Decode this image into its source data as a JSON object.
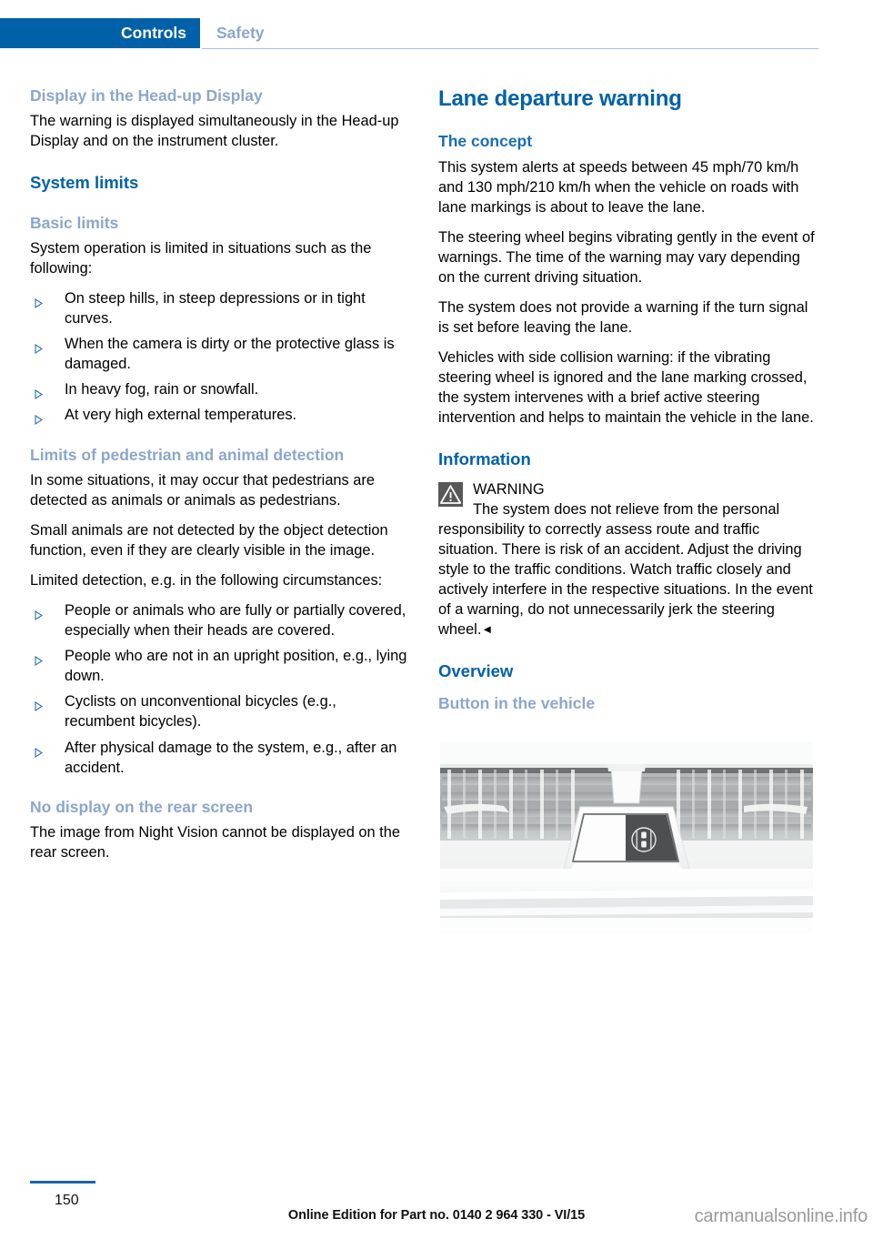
{
  "header": {
    "tab_active": "Controls",
    "tab_inactive": "Safety",
    "accent_color": "#0061a8",
    "muted_color": "#8ba7cc"
  },
  "left_column": {
    "h3_headup": "Display in the Head-up Display",
    "p_headup": "The warning is displayed simultaneously in the Head-up Display and on the instrument cluster.",
    "h2_system_limits": "System limits",
    "h3_basic_limits": "Basic limits",
    "p_basic_intro": "System operation is limited in situations such as the following:",
    "basic_limits_items": [
      "On steep hills, in steep depressions or in tight curves.",
      "When the camera is dirty or the protective glass is damaged.",
      "In heavy fog, rain or snowfall.",
      "At very high external temperatures."
    ],
    "h3_limits_detection": "Limits of pedestrian and animal detection",
    "p_detection_1": "In some situations, it may occur that pedestrians are detected as animals or animals as pedestrians.",
    "p_detection_2": "Small animals are not detected by the object detection function, even if they are clearly visible in the image.",
    "p_detection_3": "Limited detection, e.g. in the following circumstances:",
    "detection_items": [
      "People or animals who are fully or partially covered, especially when their heads are covered.",
      "People who are not in an upright position, e.g., lying down.",
      "Cyclists on unconventional bicycles (e.g., recumbent bicycles).",
      "After physical damage to the system, e.g., after an accident."
    ],
    "h3_no_display": "No display on the rear screen",
    "p_no_display": "The image from Night Vision cannot be displayed on the rear screen."
  },
  "right_column": {
    "h1_title": "Lane departure warning",
    "h3_concept": "The concept",
    "p_concept_1": "This system alerts at speeds between 45 mph/70 km/h and 130 mph/210 km/h when the vehicle on roads with lane markings is about to leave the lane.",
    "p_concept_2": "The steering wheel begins vibrating gently in the event of warnings. The time of the warning may vary depending on the current driving situation.",
    "p_concept_3": "The system does not provide a warning if the turn signal is set before leaving the lane.",
    "p_concept_4": "Vehicles with side collision warning: if the vibrating steering wheel is ignored and the lane marking crossed, the system intervenes with a brief active steering intervention and helps to maintain the vehicle in the lane.",
    "h2_information": "Information",
    "warning_label": "WARNING",
    "warning_text": "The system does not relieve from the personal responsibility to correctly assess route and traffic situation. There is risk of an accident. Adjust the driving style to the traffic conditions. Watch traffic closely and actively interfere in the respective situations. In the event of a warning, do not unnecessarily jerk the steering wheel.",
    "warning_endmark": "◄",
    "h2_overview": "Overview",
    "h3_button_vehicle": "Button in the vehicle",
    "figure_caption": ""
  },
  "footer": {
    "page_number": "150",
    "edition_text": "Online Edition for Part no. 0140 2 964 330 - VI/15",
    "watermark": "carmanualsonline.info"
  }
}
